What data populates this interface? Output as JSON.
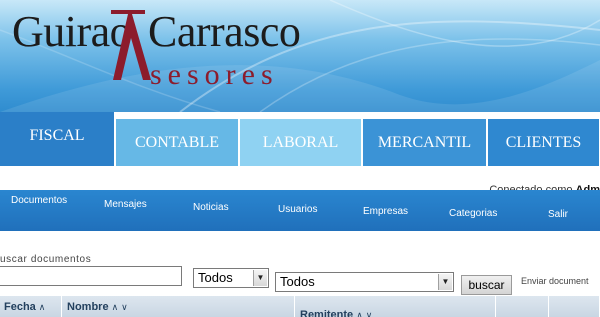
{
  "logo": {
    "word_top_1": "Guirao",
    "word_top_2": "Carrasco",
    "word_bottom": "sesores"
  },
  "colors": {
    "logo_accent": "#8c1c2c",
    "tab_active": "#2b7fc8",
    "subnav_bg": "#2070bb"
  },
  "tabs": [
    {
      "label": "FISCAL"
    },
    {
      "label": "CONTABLE"
    },
    {
      "label": "LABORAL"
    },
    {
      "label": "MERCANTIL"
    },
    {
      "label": "CLIENTES"
    }
  ],
  "user_status": {
    "prefix": "Conectado como",
    "user": "Adm"
  },
  "subnav": [
    {
      "label": "Documentos"
    },
    {
      "label": "Mensajes"
    },
    {
      "label": "Noticias"
    },
    {
      "label": "Usuarios"
    },
    {
      "label": "Empresas"
    },
    {
      "label": "Categorias"
    },
    {
      "label": "Salir"
    }
  ],
  "search": {
    "label": "uscar documentos",
    "query": "",
    "filter_1": "Todos",
    "filter_2": "Todos",
    "button": "buscar",
    "send_link": "Enviar document"
  },
  "table": {
    "columns": [
      {
        "label": "Fecha",
        "sort_up": "∧",
        "sort_down": "∨"
      },
      {
        "label": "Nombre",
        "sort_up": "∧",
        "sort_down": "∨"
      },
      {
        "label": "Remitente",
        "sort_up": "∧",
        "sort_down": "∨"
      }
    ]
  }
}
